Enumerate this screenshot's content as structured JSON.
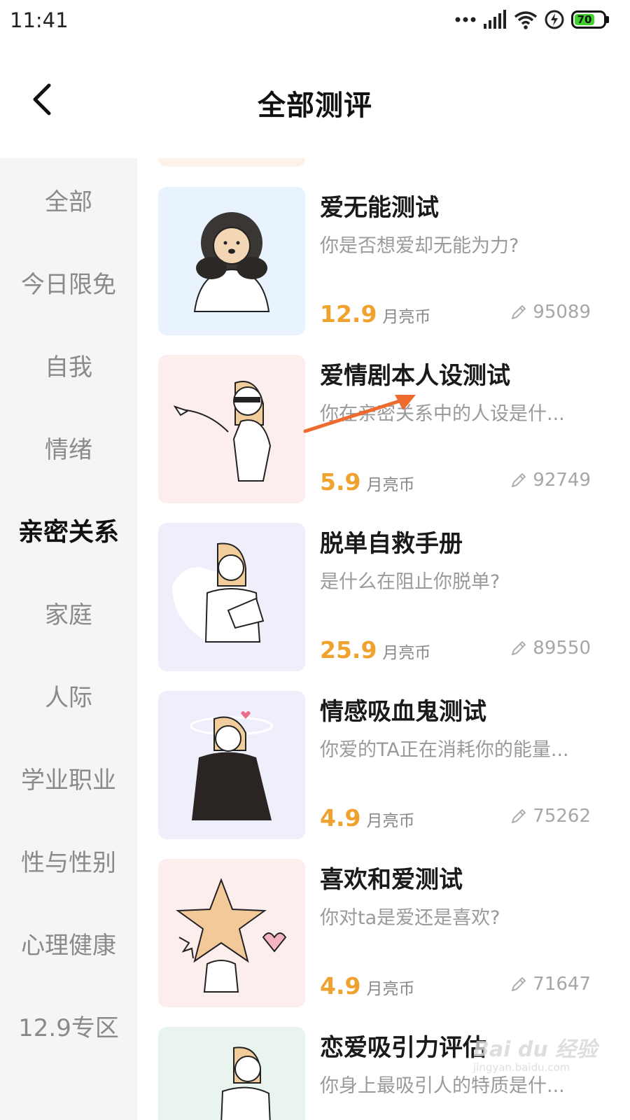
{
  "status_bar": {
    "time": "11:41",
    "battery_level": "70",
    "icons": [
      "more-dots-icon",
      "signal-icon",
      "wifi-icon",
      "charging-icon",
      "battery-icon"
    ]
  },
  "header": {
    "title": "全部测评",
    "back_icon": "chevron-left-icon"
  },
  "sidebar": {
    "active_index": 4,
    "items": [
      {
        "label": "全部"
      },
      {
        "label": "今日限免"
      },
      {
        "label": "自我"
      },
      {
        "label": "情绪"
      },
      {
        "label": "亲密关系"
      },
      {
        "label": "家庭"
      },
      {
        "label": "人际"
      },
      {
        "label": "学业职业"
      },
      {
        "label": "性与性别"
      },
      {
        "label": "心理健康"
      },
      {
        "label": "12.9专区"
      }
    ]
  },
  "cards": [
    {
      "title": "爱无能测试",
      "desc": "你是否想爱却无能为力?",
      "price": "12.9",
      "unit": "月亮币",
      "count": "95089",
      "thumb_bg": "#e8f3fd",
      "thumb_art": "lion-character"
    },
    {
      "title": "爱情剧本人设测试",
      "desc": "你在亲密关系中的人设是什...",
      "price": "5.9",
      "unit": "月亮币",
      "count": "92749",
      "thumb_bg": "#fdeeee",
      "thumb_art": "masked-character"
    },
    {
      "title": "脱单自救手册",
      "desc": "是什么在阻止你脱单?",
      "price": "25.9",
      "unit": "月亮币",
      "count": "89550",
      "thumb_bg": "#efeffb",
      "thumb_art": "reading-character"
    },
    {
      "title": "情感吸血鬼测试",
      "desc": "你爱的TA正在消耗你的能量...",
      "price": "4.9",
      "unit": "月亮币",
      "count": "75262",
      "thumb_bg": "#efeffb",
      "thumb_art": "cloaked-character"
    },
    {
      "title": "喜欢和爱测试",
      "desc": "你对ta是爱还是喜欢?",
      "price": "4.9",
      "unit": "月亮币",
      "count": "71647",
      "thumb_bg": "#fdeeee",
      "thumb_art": "star-character"
    },
    {
      "title": "恋爱吸引力评估",
      "desc": "你身上最吸引人的特质是什...",
      "price": "",
      "unit": "",
      "count": "",
      "thumb_bg": "#eaf4ef",
      "thumb_art": "person-character"
    }
  ],
  "count_icon": "pencil-icon",
  "annotation": {
    "arrow_color": "#ef6a2e"
  },
  "watermark": {
    "text": "Bai du 经验",
    "domain": "jingyan.baidu.com"
  }
}
